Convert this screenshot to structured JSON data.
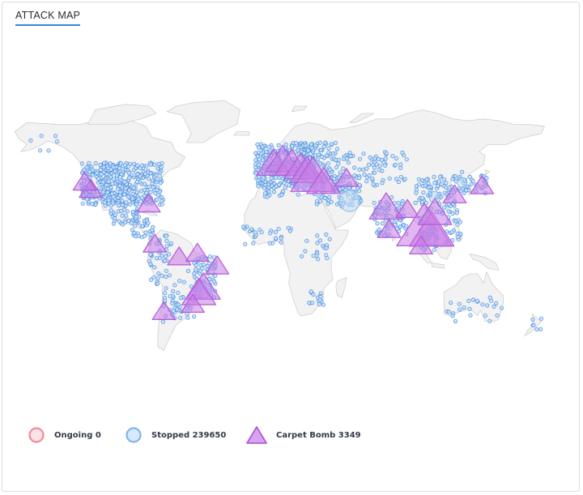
{
  "header": {
    "title": "ATTACK MAP"
  },
  "legend": [
    {
      "name": "Ongoing",
      "count": "0",
      "label": "Ongoing 0",
      "color": "#f08a9a",
      "fill": "#fbe3e7",
      "shape": "circle"
    },
    {
      "name": "Stopped",
      "count": "239650",
      "label": "Stopped 239650",
      "color": "#7eb6ea",
      "fill": "#d7e9fa",
      "shape": "circle"
    },
    {
      "name": "Carpet Bomb",
      "count": "3349",
      "label": "Carpet Bomb 3349",
      "color": "#b35ad8",
      "fill": "#d9a4ee",
      "shape": "triangle"
    }
  ],
  "map": {
    "land_color": "#f2f2f2",
    "border_color": "#cfcfcf",
    "stopped_color": "#4a90e2",
    "bomb_color": "#b35ad8",
    "carpet_bomb_hotspots": [
      {
        "lon": -118,
        "lat": 34,
        "size": 1
      },
      {
        "lon": -122,
        "lat": 38,
        "size": 1
      },
      {
        "lon": -80,
        "lat": 26,
        "size": 1
      },
      {
        "lon": -76,
        "lat": 4,
        "size": 1
      },
      {
        "lon": -60,
        "lat": -3,
        "size": 1
      },
      {
        "lon": -48,
        "lat": -1,
        "size": 1
      },
      {
        "lon": -35,
        "lat": -8,
        "size": 1
      },
      {
        "lon": -44,
        "lat": -20,
        "size": 2
      },
      {
        "lon": -47,
        "lat": -23,
        "size": 2
      },
      {
        "lon": -51,
        "lat": -29,
        "size": 1
      },
      {
        "lon": -70,
        "lat": -33,
        "size": 1
      },
      {
        "lon": 2,
        "lat": 48,
        "size": 2
      },
      {
        "lon": 8,
        "lat": 50,
        "size": 2
      },
      {
        "lon": 14,
        "lat": 48,
        "size": 2
      },
      {
        "lon": 20,
        "lat": 46,
        "size": 2
      },
      {
        "lon": 24,
        "lat": 44,
        "size": 2
      },
      {
        "lon": 28,
        "lat": 41,
        "size": 3
      },
      {
        "lon": 35,
        "lat": 38,
        "size": 2
      },
      {
        "lon": 50,
        "lat": 40,
        "size": 1
      },
      {
        "lon": 76,
        "lat": 24,
        "size": 2
      },
      {
        "lon": 78,
        "lat": 12,
        "size": 1
      },
      {
        "lon": 90,
        "lat": 23,
        "size": 1
      },
      {
        "lon": 101,
        "lat": 13,
        "size": 4
      },
      {
        "lon": 106,
        "lat": 11,
        "size": 3
      },
      {
        "lon": 108,
        "lat": 21,
        "size": 2
      },
      {
        "lon": 121,
        "lat": 31,
        "size": 1
      },
      {
        "lon": 139,
        "lat": 36,
        "size": 1
      },
      {
        "lon": 99,
        "lat": 3,
        "size": 1
      }
    ]
  }
}
